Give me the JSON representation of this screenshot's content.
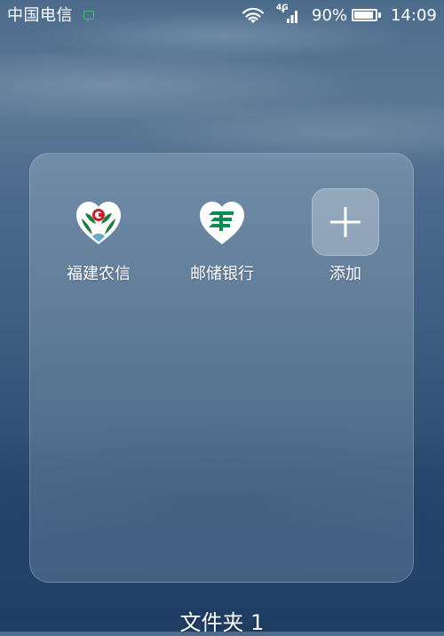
{
  "status_bar": {
    "carrier": "中国电信",
    "network_type": "4G",
    "battery_percent_text": "90%",
    "battery_level": 0.9,
    "time": "14:09",
    "icons": [
      "message-icon",
      "wifi-icon",
      "signal-icon",
      "battery-icon"
    ]
  },
  "folder": {
    "apps": [
      {
        "label": "福建农信",
        "icon": "fujian-rural-credit-icon"
      },
      {
        "label": "邮储银行",
        "icon": "postal-savings-bank-icon"
      },
      {
        "label": "添加",
        "icon": "plus-icon"
      }
    ],
    "name": "文件夹 1"
  },
  "colors": {
    "message_icon": "#3ec46d",
    "fujian_logo_green": "#1f7a3e",
    "fujian_logo_red": "#c8202a",
    "postal_logo_green": "#0d8a4f"
  }
}
